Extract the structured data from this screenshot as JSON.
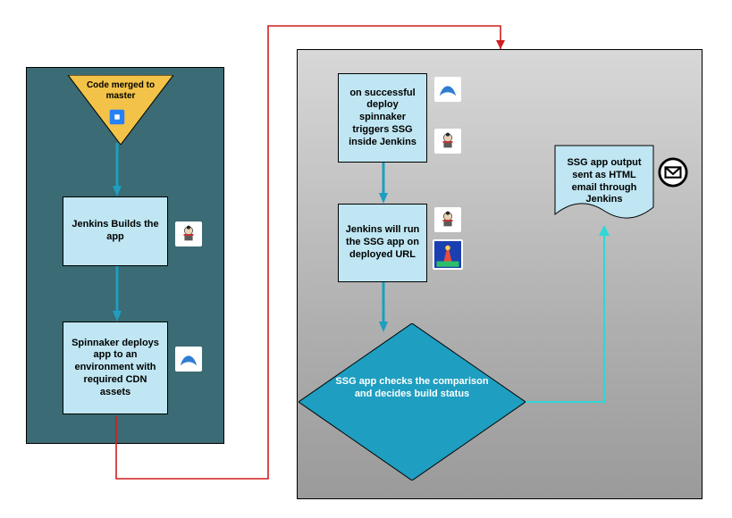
{
  "colors": {
    "box_fill": "#bfe6f2",
    "panel_left": "#3b6b74",
    "panel_right_grad": [
      "#d8d8d8",
      "#9a9a9a"
    ],
    "decision_fill": "#1e9ec0",
    "triangle_fill": "#f2c348",
    "arrow_blue": "#1e9ec0",
    "arrow_red": "#d21e1e",
    "arrow_cyan": "#2fd7d7"
  },
  "left": {
    "triangle_label": "Code merged to master",
    "box_jenkins": "Jenkins Builds the app",
    "box_spinnaker": "Spinnaker deploys app to an environment with required CDN assets"
  },
  "right": {
    "box_success": "on successful deploy spinnaker triggers SSG inside Jenkins",
    "box_run": "Jenkins will run the SSG app on deployed URL",
    "decision": "SSG app checks the comparison and decides build status",
    "doc_email": "SSG app output sent as HTML email through Jenkins"
  },
  "icons": {
    "bitbucket": "bitbucket-icon",
    "jenkins": "jenkins-icon",
    "spinnaker": "spinnaker-icon",
    "lighthouse": "lighthouse-icon",
    "email": "email-icon"
  }
}
